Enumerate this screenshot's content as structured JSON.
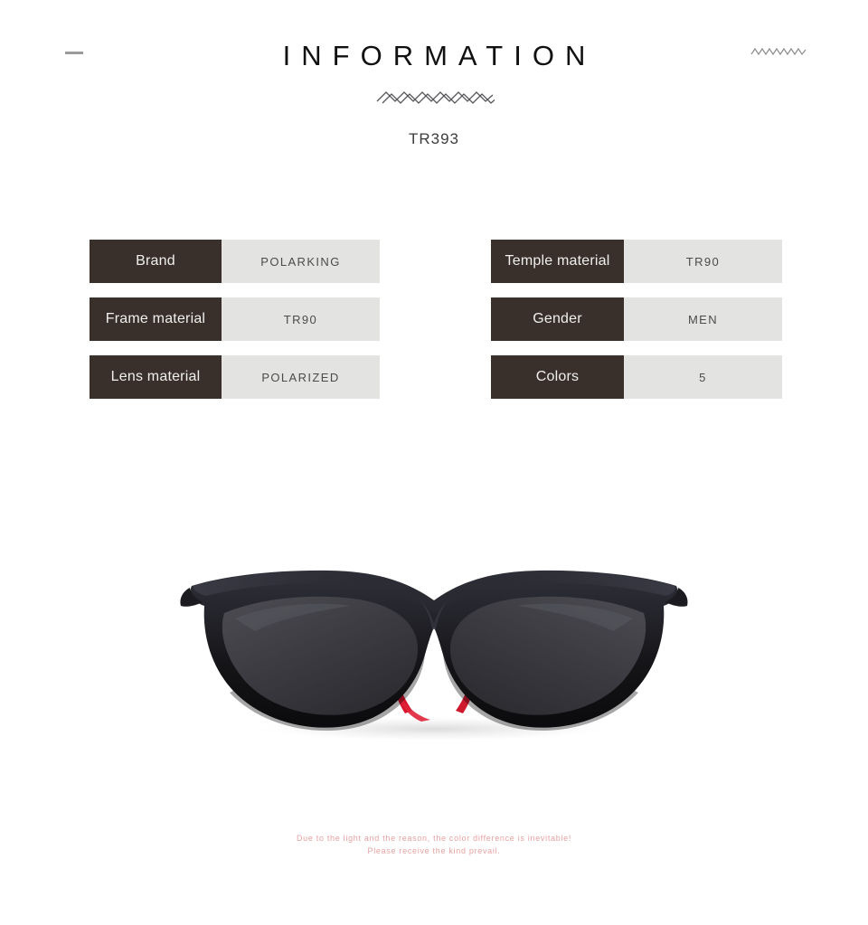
{
  "header": {
    "title": "INFORMATION",
    "subtitle": "TR393",
    "left_dash_icon": "dash-icon",
    "right_zigzag_icon": "zigzag-icon",
    "divider_zigzag_icon": "zigzag-divider-icon"
  },
  "specs": {
    "left_table": [
      {
        "label": "Brand",
        "value": "POLARKING"
      },
      {
        "label": "Frame material",
        "value": "TR90"
      },
      {
        "label": "Lens material",
        "value": "POLARIZED"
      }
    ],
    "right_table": [
      {
        "label": "Temple material",
        "value": "TR90"
      },
      {
        "label": "Gender",
        "value": "MEN"
      },
      {
        "label": "Colors",
        "value": "5"
      }
    ]
  },
  "product": {
    "image_name": "sunglasses-front-view",
    "frame_color": "#1a1a1c",
    "lens_color": "#3b3b40",
    "accent_color": "#e0243a"
  },
  "footer": {
    "line1": "Due to the light and the reason, the color difference is inevitable!",
    "line2": "Please receive the kind prevail.",
    "color": "#e8a2a2"
  },
  "theme": {
    "label_bg": "#39302c",
    "value_bg": "#e3e3e1",
    "label_text": "#f0efec",
    "value_text": "#4b4b4b",
    "page_bg": "#ffffff"
  }
}
